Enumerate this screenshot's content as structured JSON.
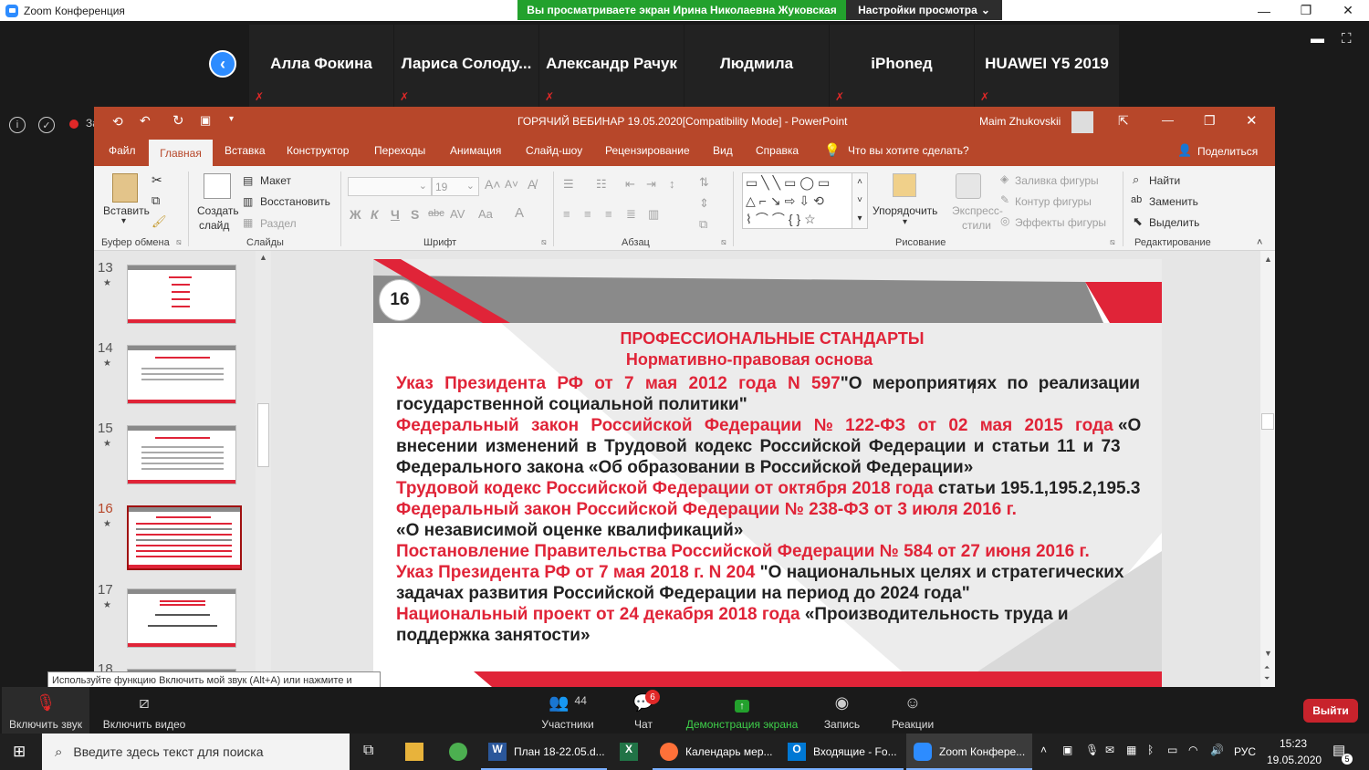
{
  "zoom": {
    "window_title": "Zoom Конференция",
    "share_banner": "Вы просматриваете экран Ирина Николаевна Жуковская",
    "view_options": "Настройки просмотра",
    "participants": [
      "Алла Фокина",
      "Лариса Солоду...",
      "Александр Рачук",
      "Людмила",
      "iPhoneд",
      "HUAWEI Y5 2019"
    ],
    "recording_label": "Запись",
    "tooltip": "Используйте функцию Включить мой звук (Alt+A) или нажмите и удерживайте клавишу ПРОБЕЛ, чтобы временно включить звук.",
    "toolbar": {
      "unmute": "Включить звук",
      "video": "Включить видео",
      "participants": "Участники",
      "participants_count": "44",
      "chat": "Чат",
      "chat_badge": "6",
      "share": "Демонстрация экрана",
      "record": "Запись",
      "reactions": "Реакции",
      "leave": "Выйти"
    },
    "colors": {
      "share_green": "#23a12d",
      "accent_blue": "#2d8cff",
      "leave_red": "#c8232c"
    }
  },
  "powerpoint": {
    "title": "ГОРЯЧИЙ ВЕБИНАР 19.05.2020[Compatibility Mode]  -  PowerPoint",
    "user": "Maim Zhukovskii",
    "tabs": [
      "Файл",
      "Главная",
      "Вставка",
      "Конструктор",
      "Переходы",
      "Анимация",
      "Слайд-шоу",
      "Рецензирование",
      "Вид",
      "Справка"
    ],
    "tell_me": "Что вы хотите сделать?",
    "share": "Поделиться",
    "ribbon": {
      "paste": "Вставить",
      "clipboard": "Буфер обмена",
      "new_slide_1": "Создать",
      "new_slide_2": "слайд",
      "layout": "Макет",
      "reset": "Восстановить",
      "section": "Раздел",
      "slides": "Слайды",
      "font_size": "19",
      "font": "Шрифт",
      "paragraph": "Абзац",
      "arrange": "Упорядочить",
      "quick_styles_1": "Экспресс-",
      "quick_styles_2": "стили",
      "shape_fill": "Заливка фигуры",
      "shape_outline": "Контур фигуры",
      "shape_effects": "Эффекты фигуры",
      "drawing": "Рисование",
      "find": "Найти",
      "replace": "Заменить",
      "select": "Выделить",
      "editing": "Редактирование"
    },
    "thumbnails": [
      "13",
      "14",
      "15",
      "16",
      "17",
      "18"
    ],
    "current_slide": "16",
    "slide": {
      "number": "16",
      "title": "ПРОФЕССИОНАЛЬНЫЕ СТАНДАРТЫ",
      "subtitle": "Нормативно-правовая основа",
      "l1r": "Указ Президента РФ от 7 мая 2012 года N 597",
      "l1b": "\"О мероприятиях по реализации",
      "l2b": "государственной социальной политики\"",
      "l3r": "Федеральный закон Российской Федерации № 122-ФЗ от 02 мая 2015 года",
      "l3b": " «О",
      "l4b": "внесении изменений в Трудовой кодекс Российской Федерации и статьи 11 и 73",
      "l5b": "Федерального закона «Об образовании в Российской Федерации»",
      "l6r": "Трудовой кодекс Российской Федерации от октября 2018 года",
      "l6b": " статьи 195.1,195.2,195.3",
      "l7r": "Федеральный закон Российской Федерации № 238-ФЗ от 3 июля 2016 г.",
      "l8b": "«О независимой оценке квалификаций»",
      "l9r": "Постановление Правительства Российской Федерации № 584 от 27 июня 2016 г.",
      "l10r": "Указ Президента РФ от 7 мая 2018 г. N 204",
      "l10b": "  \"О национальных целях и стратегических",
      "l11b": "задачах развития Российской Федерации на период до 2024 года\"",
      "l12r": "Национальный проект от 24 декабря 2018 года",
      "l12b": " «Производительность труда и",
      "l13b": "поддержка занятости»"
    },
    "colors": {
      "ribbon": "#b7472a",
      "slide_red": "#e02438",
      "slide_gray": "#8a8a8a"
    }
  },
  "taskbar": {
    "search": "Введите здесь текст для поиска",
    "apps": [
      "План 18-22.05.d...",
      "Календарь мер...",
      "Входящие - Fo...",
      "Zoom Конфере..."
    ],
    "lang": "РУС",
    "time": "15:23",
    "date": "19.05.2020",
    "notif": "5"
  }
}
